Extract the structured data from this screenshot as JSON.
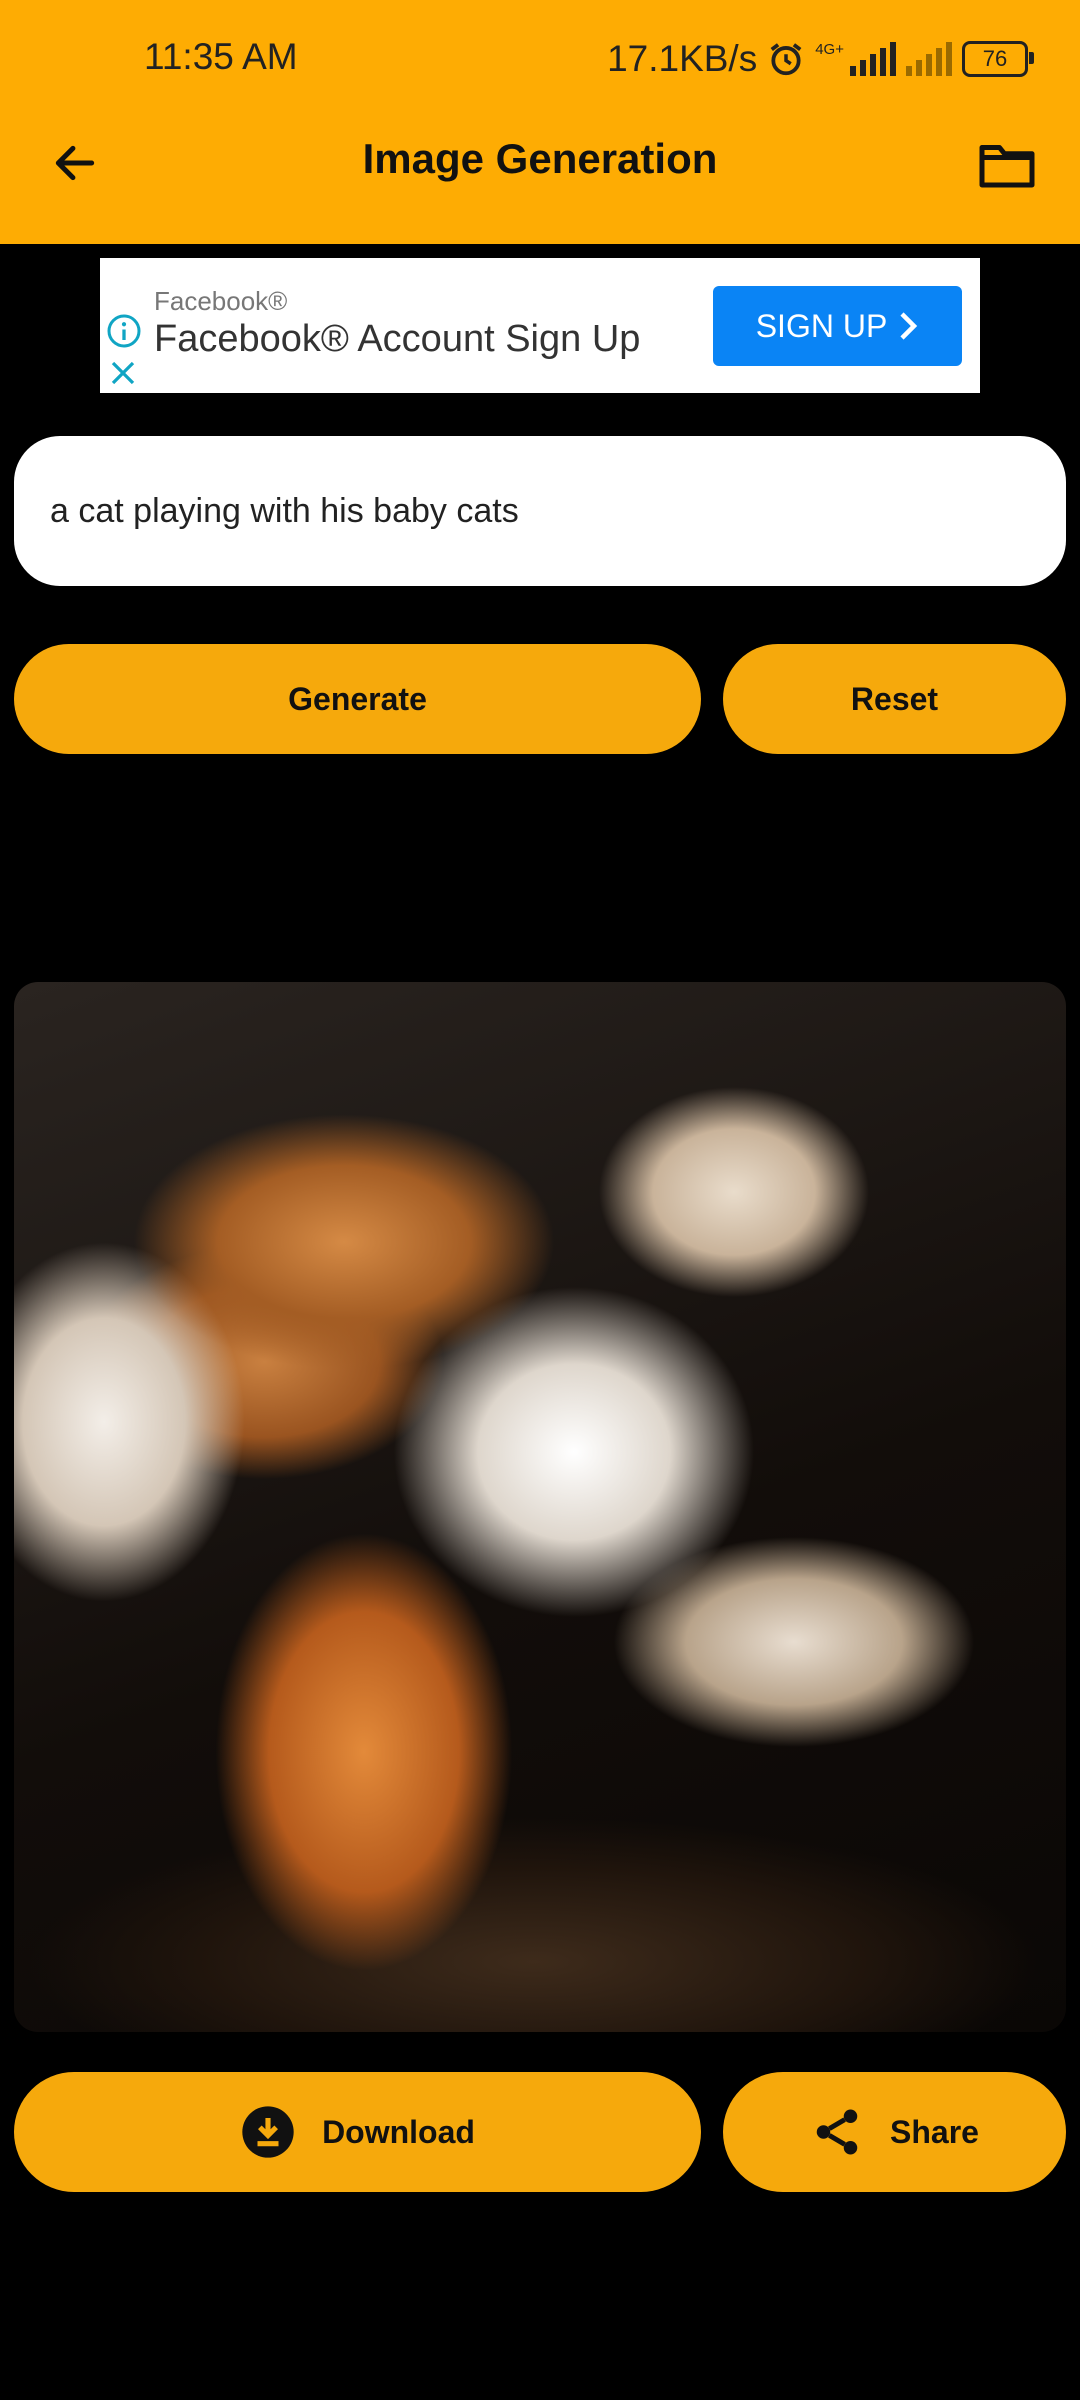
{
  "status_bar": {
    "time": "11:35 AM",
    "speed": "17.1KB/s",
    "network_type": "4G+",
    "battery": "76"
  },
  "app_bar": {
    "title": "Image Generation",
    "back_icon": "arrow-left-icon",
    "folder_icon": "folder-icon"
  },
  "ad": {
    "brand": "Facebook®",
    "title": "Facebook® Account Sign Up",
    "cta": "SIGN UP",
    "cta_color": "#0A84F5"
  },
  "prompt": {
    "value": "a cat playing with his baby cats"
  },
  "actions": {
    "generate_label": "Generate",
    "reset_label": "Reset",
    "download_label": "Download",
    "share_label": "Share"
  },
  "colors": {
    "accent": "#FEAC03",
    "button": "#F6A90C",
    "background": "#000000"
  }
}
